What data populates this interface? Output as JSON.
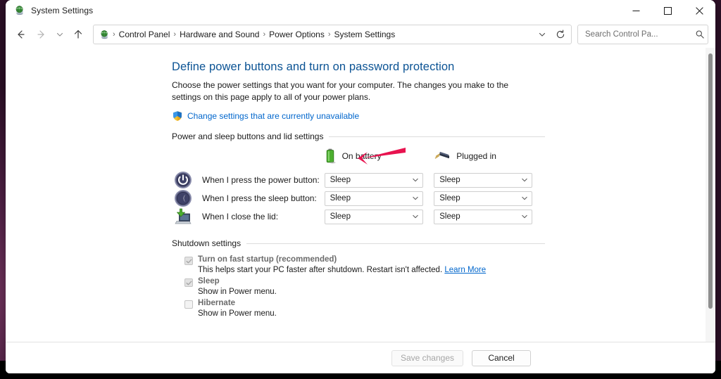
{
  "window": {
    "title": "System Settings",
    "title_icon": "system-settings-icon",
    "controls": {
      "minimize": "Minimize",
      "maximize": "Maximize",
      "close": "Close"
    }
  },
  "nav": {
    "back": "Back",
    "forward": "Forward",
    "recent": "Recent locations",
    "up": "Up one level",
    "dropdown": "Previous locations",
    "refresh": "Refresh"
  },
  "breadcrumb": {
    "icon": "control-panel-icon",
    "separator": "›",
    "items": [
      {
        "label": "Control Panel"
      },
      {
        "label": "Hardware and Sound"
      },
      {
        "label": "Power Options"
      },
      {
        "label": "System Settings"
      }
    ]
  },
  "search": {
    "placeholder": "Search Control Pa...",
    "value": "",
    "icon": "search-icon"
  },
  "page": {
    "title": "Define power buttons and turn on password protection",
    "intro": "Choose the power settings that you want for your computer. The changes you make to the settings on this page apply to all of your power plans.",
    "uac_link": "Change settings that are currently unavailable",
    "uac_icon": "uac-shield-icon"
  },
  "annotation": {
    "arrow_color": "#e8134f",
    "points_to": "Change settings that are currently unavailable"
  },
  "power_section": {
    "heading": "Power and sleep buttons and lid settings",
    "columns": [
      {
        "label": "On battery",
        "icon": "battery-icon"
      },
      {
        "label": "Plugged in",
        "icon": "power-plug-icon"
      }
    ],
    "rows": [
      {
        "icon": "power-button-icon",
        "label": "When I press the power button:",
        "on_battery": "Sleep",
        "plugged_in": "Sleep"
      },
      {
        "icon": "sleep-button-icon",
        "label": "When I press the sleep button:",
        "on_battery": "Sleep",
        "plugged_in": "Sleep"
      },
      {
        "icon": "laptop-lid-icon",
        "label": "When I close the lid:",
        "on_battery": "Sleep",
        "plugged_in": "Sleep"
      }
    ]
  },
  "shutdown_section": {
    "heading": "Shutdown settings",
    "options": [
      {
        "label": "Turn on fast startup (recommended)",
        "checked": true,
        "disabled": true,
        "description": "This helps start your PC faster after shutdown. Restart isn't affected.",
        "link": "Learn More"
      },
      {
        "label": "Sleep",
        "checked": true,
        "disabled": true,
        "description": "Show in Power menu.",
        "link": ""
      },
      {
        "label": "Hibernate",
        "checked": false,
        "disabled": true,
        "description": "Show in Power menu.",
        "link": ""
      }
    ]
  },
  "footer": {
    "save_label": "Save changes",
    "save_disabled": true,
    "cancel_label": "Cancel"
  },
  "colors": {
    "heading": "#0b5394",
    "link": "#0066cc",
    "accent_arrow": "#e8134f",
    "battery_green": "#4caf2f"
  }
}
